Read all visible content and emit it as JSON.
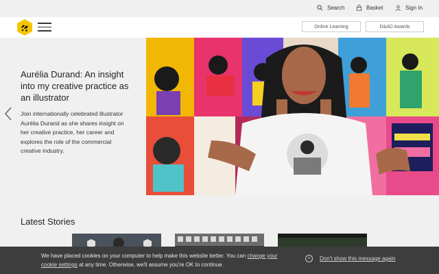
{
  "topbar": {
    "search_label": "Search",
    "basket_label": "Basket",
    "signin_label": "Sign In"
  },
  "header": {
    "online_learning_label": "Online Learning",
    "awards_label": "D&AD Awards",
    "brand_color": "#f7c500"
  },
  "hero": {
    "title": "Aurélia Durand: An insight into my creative practice as an illustrator",
    "description": "Join internationally celebrated illustrator Aurélia Durand as she shares insight on her creative practice, her career and explores the role of the commercial creative industry."
  },
  "stories": {
    "heading": "Latest Stories"
  },
  "cookie": {
    "text_before": "We have placed cookies on your computer to help make this website better. You can ",
    "link_text": "change your cookie settings",
    "text_after": " at any time. Otherwise, we'll assume you're OK to continue.",
    "dismiss_label": "Don't show this message again"
  },
  "icons": {
    "search": "search-icon",
    "basket": "basket-icon",
    "user": "user-icon",
    "logo": "dad-logo",
    "menu": "hamburger-icon",
    "prev": "chevron-left-icon",
    "close": "close-circle-icon"
  }
}
